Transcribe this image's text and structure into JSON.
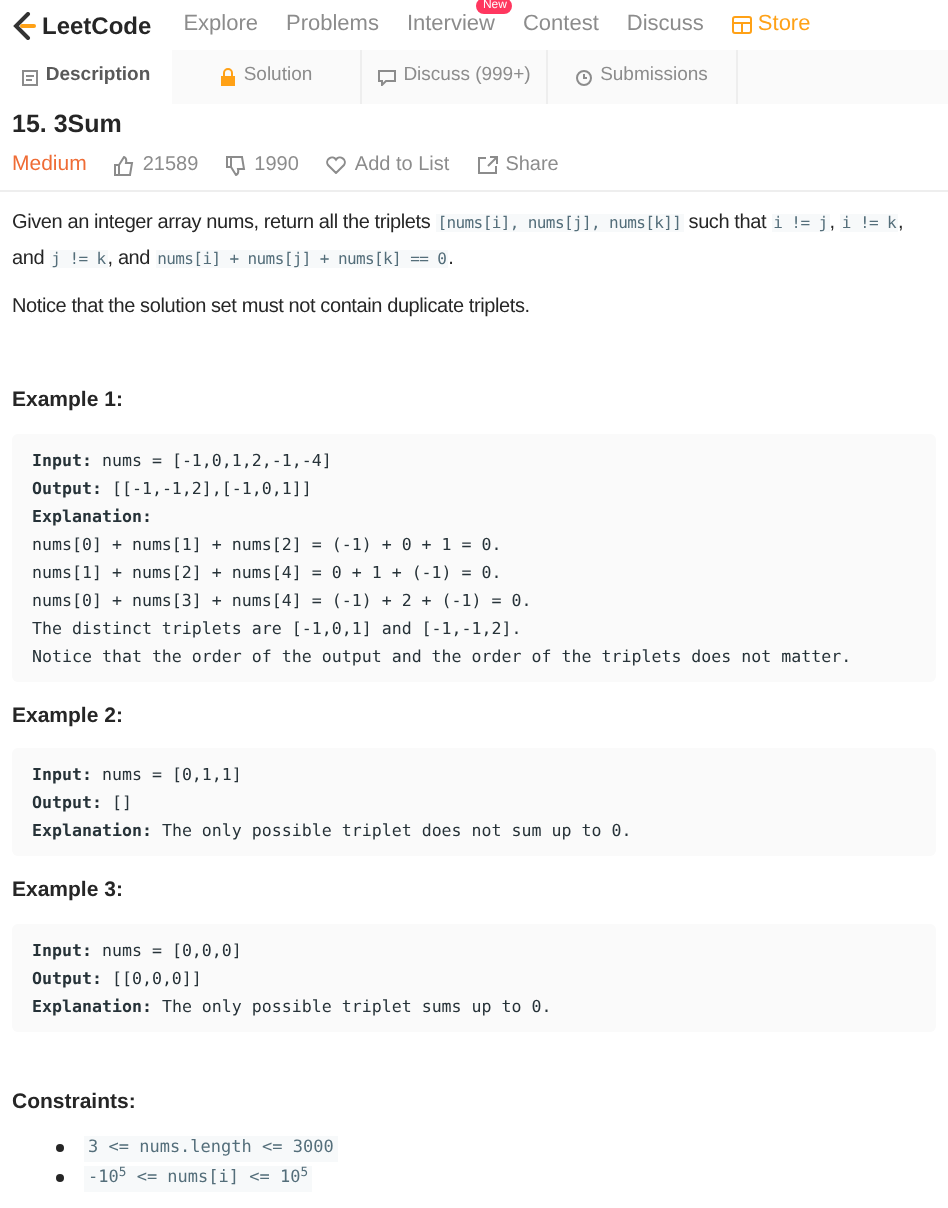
{
  "nav": {
    "logo": "LeetCode",
    "links": [
      {
        "label": "Explore"
      },
      {
        "label": "Problems"
      },
      {
        "label": "Interview",
        "badge": "New"
      },
      {
        "label": "Contest"
      },
      {
        "label": "Discuss"
      }
    ],
    "store": "Store"
  },
  "tabs": [
    {
      "label": "Description",
      "kind": "description",
      "selected": true
    },
    {
      "label": "Solution",
      "kind": "solution",
      "selected": false
    },
    {
      "label": "Discuss (999+)",
      "kind": "discuss",
      "selected": false
    },
    {
      "label": "Submissions",
      "kind": "submissions",
      "selected": false
    }
  ],
  "problem": {
    "title": "15. 3Sum",
    "difficulty": "Medium",
    "likes": "21589",
    "dislikes": "1990",
    "add_to_list": "Add to List",
    "share": "Share"
  },
  "description": [
    [
      {
        "kind": "text",
        "text": "Given an integer array nums, return all the triplets "
      },
      {
        "kind": "code",
        "text": "[nums[i], nums[j], nums[k]]"
      },
      {
        "kind": "text",
        "text": " such that "
      },
      {
        "kind": "code",
        "text": "i != j"
      },
      {
        "kind": "text",
        "text": ", "
      },
      {
        "kind": "code",
        "text": "i != k"
      },
      {
        "kind": "text",
        "text": ", and "
      },
      {
        "kind": "code",
        "text": "j != k"
      },
      {
        "kind": "text",
        "text": ", and "
      },
      {
        "kind": "code",
        "text": "nums[i] + nums[j] + nums[k] == 0"
      },
      {
        "kind": "text",
        "text": "."
      }
    ],
    [
      {
        "kind": "text",
        "text": "Notice that the solution set must not contain duplicate triplets."
      }
    ]
  ],
  "examples": [
    {
      "heading": "Example 1:",
      "lines": [
        "**Input:** nums = [-1,0,1,2,-1,-4]",
        "**Output:** [[-1,-1,2],[-1,0,1]]",
        "**Explanation:**",
        "nums[0] + nums[1] + nums[2] = (-1) + 0 + 1 = 0.",
        "nums[1] + nums[2] + nums[4] = 0 + 1 + (-1) = 0.",
        "nums[0] + nums[3] + nums[4] = (-1) + 2 + (-1) = 0.",
        "The distinct triplets are [-1,0,1] and [-1,-1,2].",
        "Notice that the order of the output and the order of the triplets does not matter."
      ]
    },
    {
      "heading": "Example 2:",
      "lines": [
        "**Input:** nums = [0,1,1]",
        "**Output:** []",
        "**Explanation:** The only possible triplet does not sum up to 0."
      ]
    },
    {
      "heading": "Example 3:",
      "lines": [
        "**Input:** nums = [0,0,0]",
        "**Output:** [[0,0,0]]",
        "**Explanation:** The only possible triplet sums up to 0."
      ]
    }
  ],
  "constraints": {
    "heading": "Constraints:",
    "items": [
      "3 <= nums.length <= 3000",
      "-10$^{5}$ <= nums[i] <= 10$^{5}$"
    ]
  }
}
